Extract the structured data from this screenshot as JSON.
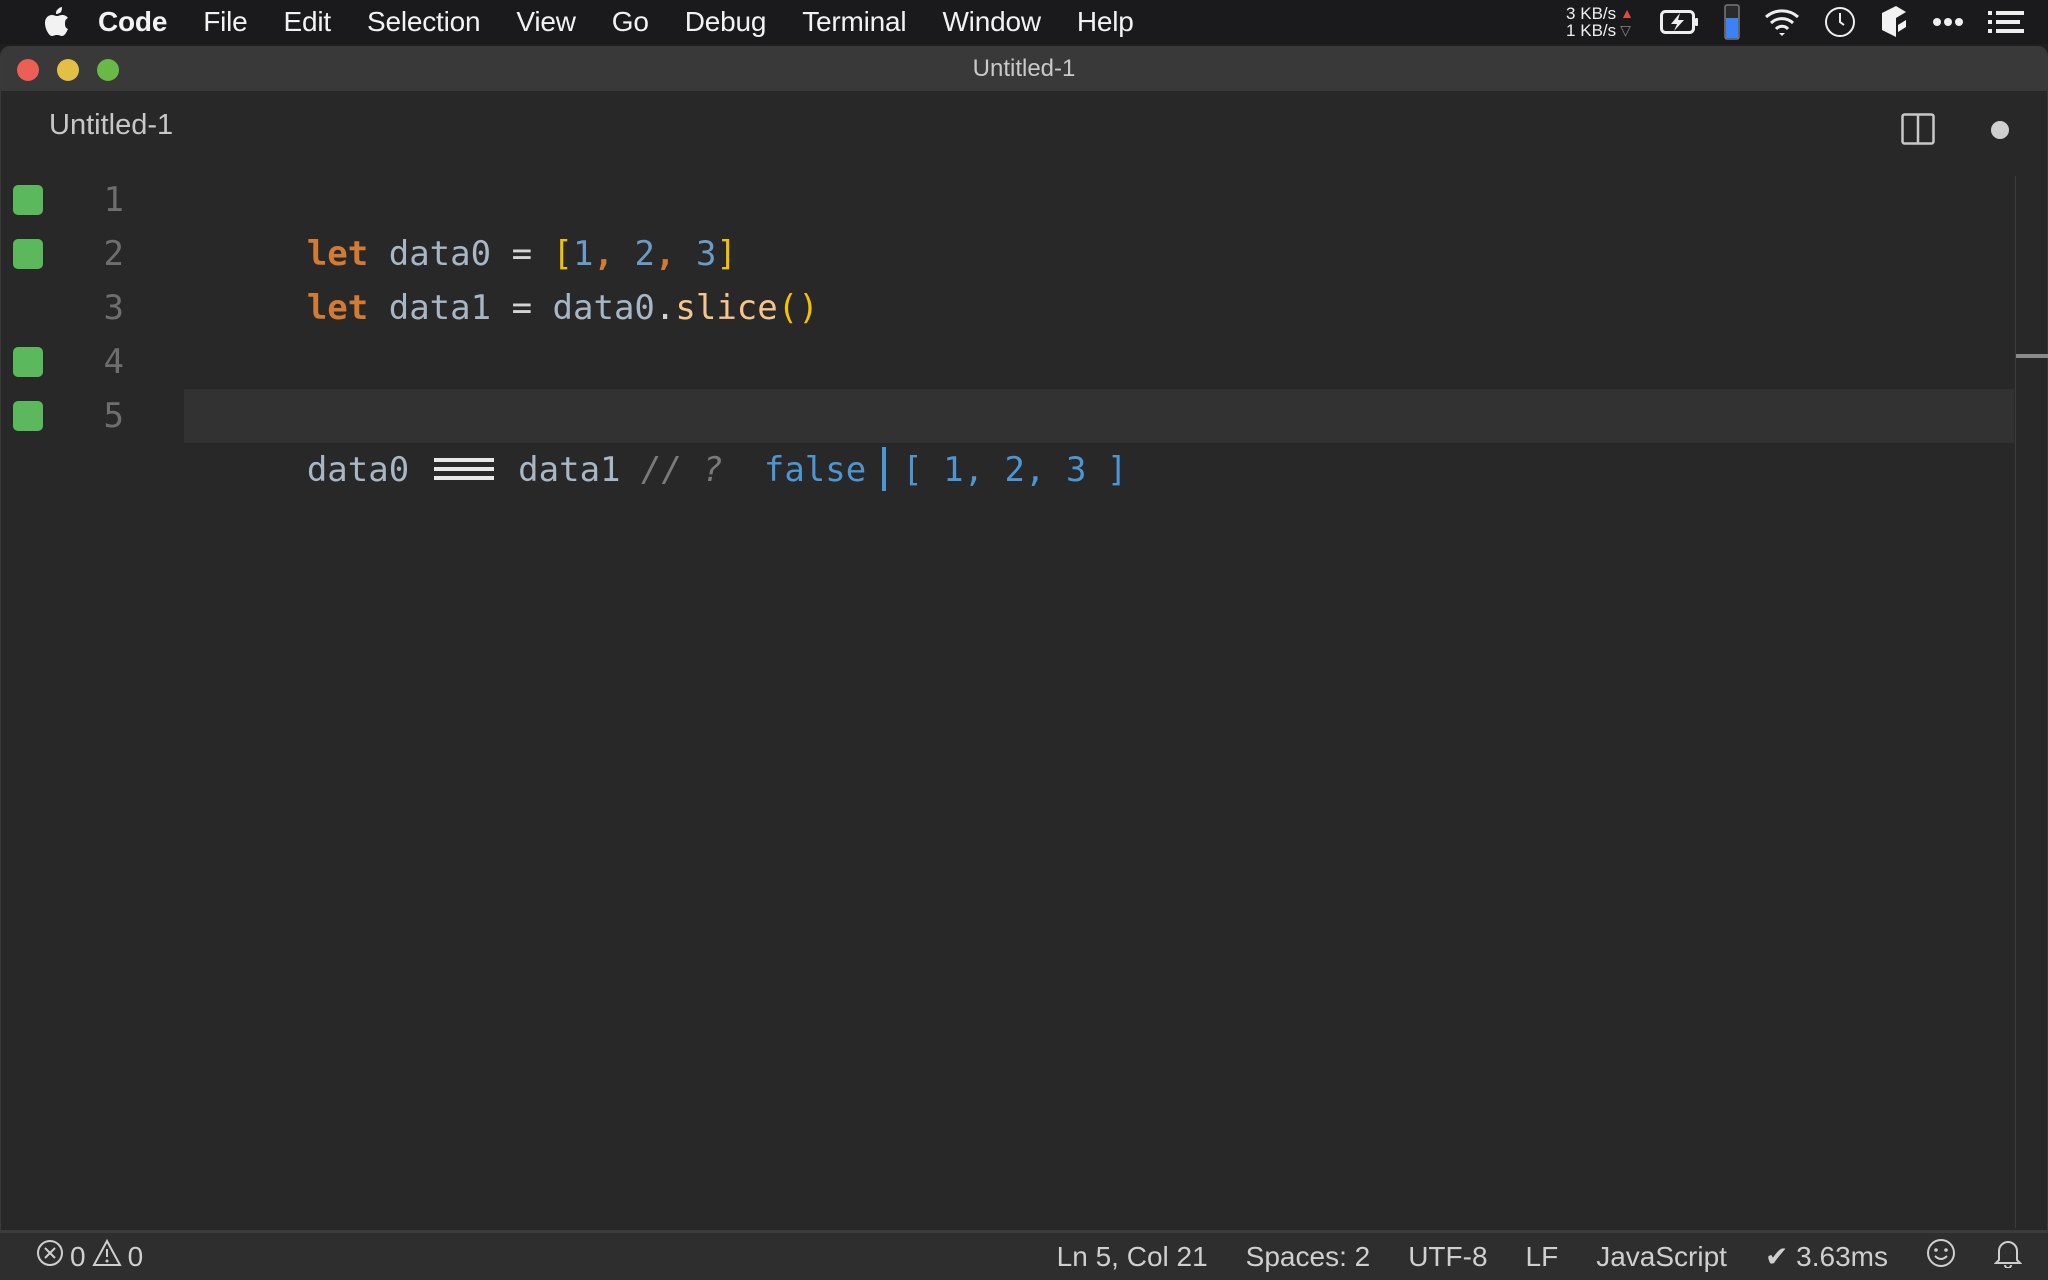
{
  "menubar": {
    "app_name": "Code",
    "items": [
      "File",
      "Edit",
      "Selection",
      "View",
      "Go",
      "Debug",
      "Terminal",
      "Window",
      "Help"
    ],
    "net_up": "3 KB/s",
    "net_down": "1 KB/s",
    "tray_icons": [
      "battery-charging-icon",
      "memory-gauge-icon",
      "wifi-icon",
      "clock-icon",
      "dropbox-like-icon",
      "more-icon",
      "list-icon"
    ]
  },
  "window": {
    "title": "Untitled-1",
    "tab_label": "Untitled-1",
    "tab_dirty": true
  },
  "editor": {
    "lines": [
      {
        "number": "1",
        "marker": true
      },
      {
        "number": "2",
        "marker": true
      },
      {
        "number": "3",
        "marker": false
      },
      {
        "number": "4",
        "marker": true
      },
      {
        "number": "5",
        "marker": true
      }
    ],
    "tokens": {
      "let": "let",
      "data0": "data0",
      "data1": "data1",
      "eq": "=",
      "lbr": "[",
      "rbr": "]",
      "n1": "1",
      "n2": "2",
      "n3": "3",
      "comma": ",",
      "dot": ".",
      "slice": "slice",
      "paren": "()",
      "comment": "// ?",
      "result_line4": "[ 1, 2, 3 ]",
      "result_line5_bool": "false",
      "result_line5_arr": "[ 1, 2, 3 ]"
    },
    "active_line": 5
  },
  "status": {
    "errors": "0",
    "warnings": "0",
    "cursor": "Ln 5, Col 21",
    "spaces": "Spaces: 2",
    "encoding": "UTF-8",
    "eol": "LF",
    "language": "JavaScript",
    "timing": "✔ 3.63ms"
  },
  "colors": {
    "keyword": "#d37a35",
    "result": "#4d96d4",
    "bracket": "#f2c200",
    "gutter_marker": "#5cb85c"
  }
}
